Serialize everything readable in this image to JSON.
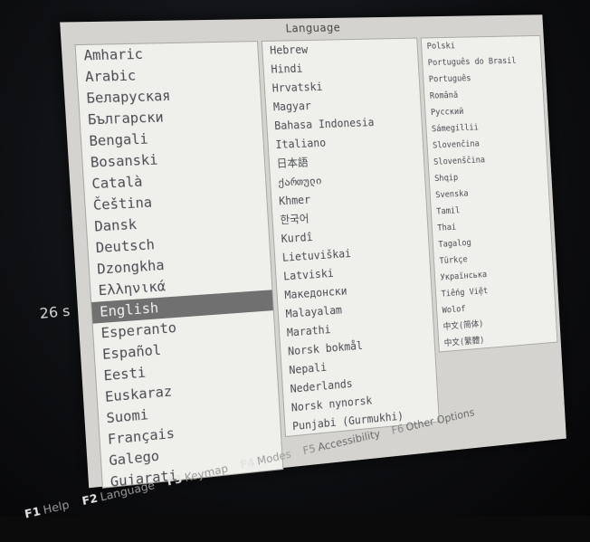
{
  "dialog": {
    "title": "Language"
  },
  "timer": {
    "text": "26 s"
  },
  "languages": {
    "column1": [
      "Amharic",
      "Arabic",
      "Беларуская",
      "Български",
      "Bengali",
      "Bosanski",
      "Català",
      "Čeština",
      "Dansk",
      "Deutsch",
      "Dzongkha",
      "Ελληνικά",
      "English",
      "Esperanto",
      "Español",
      "Eesti",
      "Euskaraz",
      "Suomi",
      "Français",
      "Galego",
      "Gujarati"
    ],
    "column2": [
      "Hebrew",
      "Hindi",
      "Hrvatski",
      "Magyar",
      "Bahasa Indonesia",
      "Italiano",
      "日本語",
      "ქართული",
      "Khmer",
      "한국어",
      "Kurdî",
      "Lietuviškai",
      "Latviski",
      "Македонски",
      "Malayalam",
      "Marathi",
      "Norsk bokmål",
      "Nepali",
      "Nederlands",
      "Norsk nynorsk",
      "Punjabi (Gurmukhi)"
    ],
    "column3": [
      "Polski",
      "Português do Brasil",
      "Português",
      "Română",
      "Русский",
      "Sámegillii",
      "Slovenčina",
      "Slovenščina",
      "Shqip",
      "Svenska",
      "Tamil",
      "Thai",
      "Tagalog",
      "Türkçe",
      "Українська",
      "Tiếng Việt",
      "Wolof",
      "中文(简体)",
      "中文(繁體)"
    ],
    "selected": "English"
  },
  "function_keys": [
    {
      "key": "F1",
      "label": "Help"
    },
    {
      "key": "F2",
      "label": "Language"
    },
    {
      "key": "F3",
      "label": "Keymap"
    },
    {
      "key": "F4",
      "label": "Modes"
    },
    {
      "key": "F5",
      "label": "Accessibility"
    },
    {
      "key": "F6",
      "label": "Other Options"
    }
  ],
  "colors": {
    "background": "#0b0b0c",
    "dialog": "#d4d3cf",
    "list": "#efefec",
    "selection": "#707071",
    "text": "#4a4c52"
  }
}
